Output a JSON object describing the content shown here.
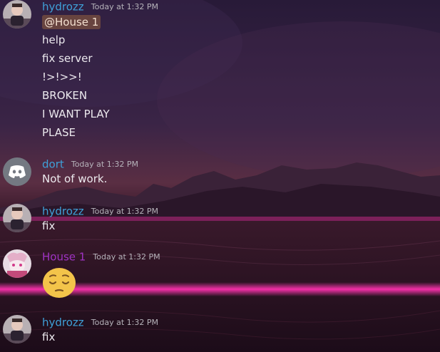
{
  "colors": {
    "user_blue": "#3fa0d8",
    "user_purple": "#a033c4",
    "timestamp": "#b6b3ba",
    "text": "#ece9ee",
    "mention_bg": "#96623e"
  },
  "messages": [
    {
      "author": "hydrozz",
      "timestamp": "Today at 1:32 PM",
      "mention": "@House 1",
      "lines": [
        "help",
        "fix server",
        "!>!>>!",
        "BROKEN",
        "I WANT PLAY",
        "PLASE"
      ]
    },
    {
      "author": "dort",
      "timestamp": "Today at 1:32 PM",
      "avatar_icon": "discord-logo-icon",
      "lines": [
        "Not of work."
      ]
    },
    {
      "author": "hydrozz",
      "timestamp": "Today at 1:32 PM",
      "lines": [
        "fix"
      ]
    },
    {
      "author": "House 1",
      "timestamp": "Today at 1:32 PM",
      "emoji": "pensive-face-emoji"
    },
    {
      "author": "hydrozz",
      "timestamp": "Today at 1:32 PM",
      "lines": [
        "fix"
      ]
    }
  ]
}
